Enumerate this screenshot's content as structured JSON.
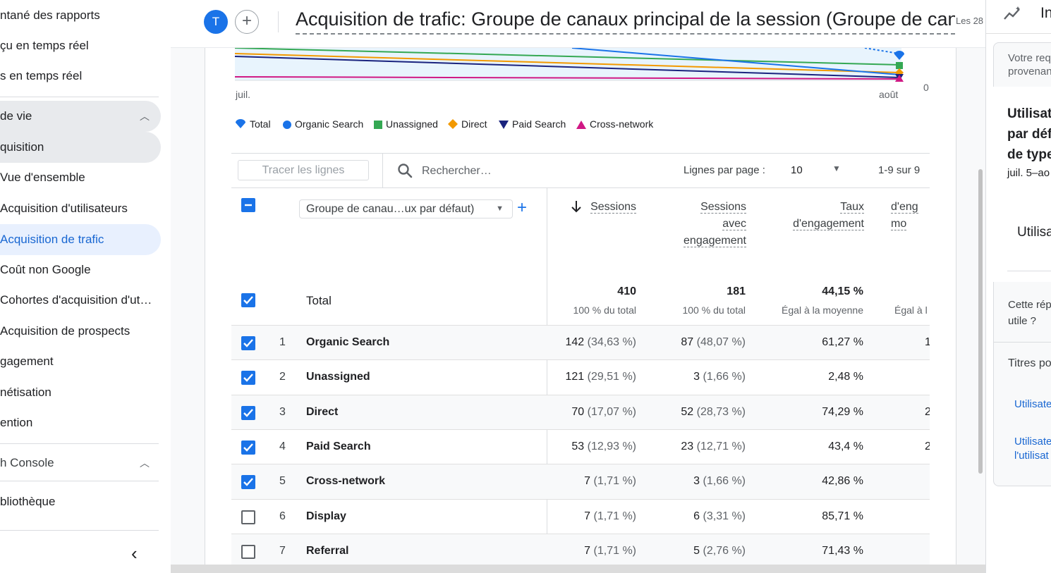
{
  "sidebar": {
    "items": [
      {
        "label": "ntané des rapports"
      },
      {
        "label": "çu en temps réel"
      },
      {
        "label": "s en temps réel"
      },
      {
        "label": " de vie"
      },
      {
        "label": "quisition"
      },
      {
        "label": "Vue d'ensemble"
      },
      {
        "label": "Acquisition d'utilisateurs"
      },
      {
        "label": "Acquisition de trafic"
      },
      {
        "label": "Coût non Google"
      },
      {
        "label": "Cohortes d'acquisition d'ut…"
      },
      {
        "label": "Acquisition de prospects"
      },
      {
        "label": "gagement"
      },
      {
        "label": "nétisation"
      },
      {
        "label": "ention"
      },
      {
        "label": "h Console"
      },
      {
        "label": "bliothèque"
      }
    ],
    "collapse_icon": "‹"
  },
  "header": {
    "avatar_initial": "T",
    "add_comparison": "+",
    "title": "Acquisition de trafic: Groupe de canaux principal de la session (Groupe de canaux par défaut)",
    "date_fragment": "Les 28"
  },
  "chart_data": {
    "type": "line",
    "x": [
      "juil.",
      "août"
    ],
    "ytick": "0",
    "series": [
      {
        "name": "Total",
        "color": "#1a73e8"
      },
      {
        "name": "Organic Search",
        "color": "#1a73e8"
      },
      {
        "name": "Unassigned",
        "color": "#34a853"
      },
      {
        "name": "Direct",
        "color": "#f29900"
      },
      {
        "name": "Paid Search",
        "color": "#1a237e"
      },
      {
        "name": "Cross-network",
        "color": "#d01884"
      }
    ]
  },
  "toolbar": {
    "plot_rows": "Tracer les lignes",
    "search_placeholder": "Rechercher…",
    "rows_per_page_label": "Lignes par page :",
    "rows_per_page": "10",
    "pagination": "1-9 sur 9"
  },
  "table": {
    "dimension": "Groupe de canau…ux par défaut)",
    "columns": [
      "Sessions",
      "Sessions avec engagement",
      "Taux d'engagement",
      "d'eng… mo…"
    ],
    "total_label": "Total",
    "totals": [
      {
        "value": "410",
        "sub": "100 % du total"
      },
      {
        "value": "181",
        "sub": "100 % du total"
      },
      {
        "value": "44,15 %",
        "sub": "Égal à la moyenne"
      },
      {
        "value": "",
        "sub": "Égal à l"
      }
    ],
    "rows": [
      {
        "index": "1",
        "name": "Organic Search",
        "checked": true,
        "sessions": "142",
        "sessions_pct": "(34,63 %)",
        "engaged": "87",
        "engaged_pct": "(48,07 %)",
        "rate": "61,27 %",
        "extra": "1"
      },
      {
        "index": "2",
        "name": "Unassigned",
        "checked": true,
        "sessions": "121",
        "sessions_pct": "(29,51 %)",
        "engaged": "3",
        "engaged_pct": "(1,66 %)",
        "rate": "2,48 %",
        "extra": ""
      },
      {
        "index": "3",
        "name": "Direct",
        "checked": true,
        "sessions": "70",
        "sessions_pct": "(17,07 %)",
        "engaged": "52",
        "engaged_pct": "(28,73 %)",
        "rate": "74,29 %",
        "extra": "2"
      },
      {
        "index": "4",
        "name": "Paid Search",
        "checked": true,
        "sessions": "53",
        "sessions_pct": "(12,93 %)",
        "engaged": "23",
        "engaged_pct": "(12,71 %)",
        "rate": "43,4 %",
        "extra": "2"
      },
      {
        "index": "5",
        "name": "Cross-network",
        "checked": true,
        "sessions": "7",
        "sessions_pct": "(1,71 %)",
        "engaged": "3",
        "engaged_pct": "(1,66 %)",
        "rate": "42,86 %",
        "extra": ""
      },
      {
        "index": "6",
        "name": "Display",
        "checked": false,
        "sessions": "7",
        "sessions_pct": "(1,71 %)",
        "engaged": "6",
        "engaged_pct": "(3,31 %)",
        "rate": "85,71 %",
        "extra": ""
      },
      {
        "index": "7",
        "name": "Referral",
        "checked": false,
        "sessions": "7",
        "sessions_pct": "(1,71 %)",
        "engaged": "5",
        "engaged_pct": "(2,76 %)",
        "rate": "71,43 %",
        "extra": ""
      }
    ]
  },
  "right_panel": {
    "title": "In",
    "request_line1": "Votre req",
    "request_line2": "provenan",
    "card_line1": "Utilisat",
    "card_line2": "par déf",
    "card_line3": "de type",
    "date": "juil. 5–ao",
    "metric": "Utilisa",
    "feedback_line1": "Cette rép",
    "feedback_line2": "utile ?",
    "titles_label": "Titres po",
    "link1": "Utilisate",
    "link2_line1": "Utilisate",
    "link2_line2": "l'utilisat"
  }
}
